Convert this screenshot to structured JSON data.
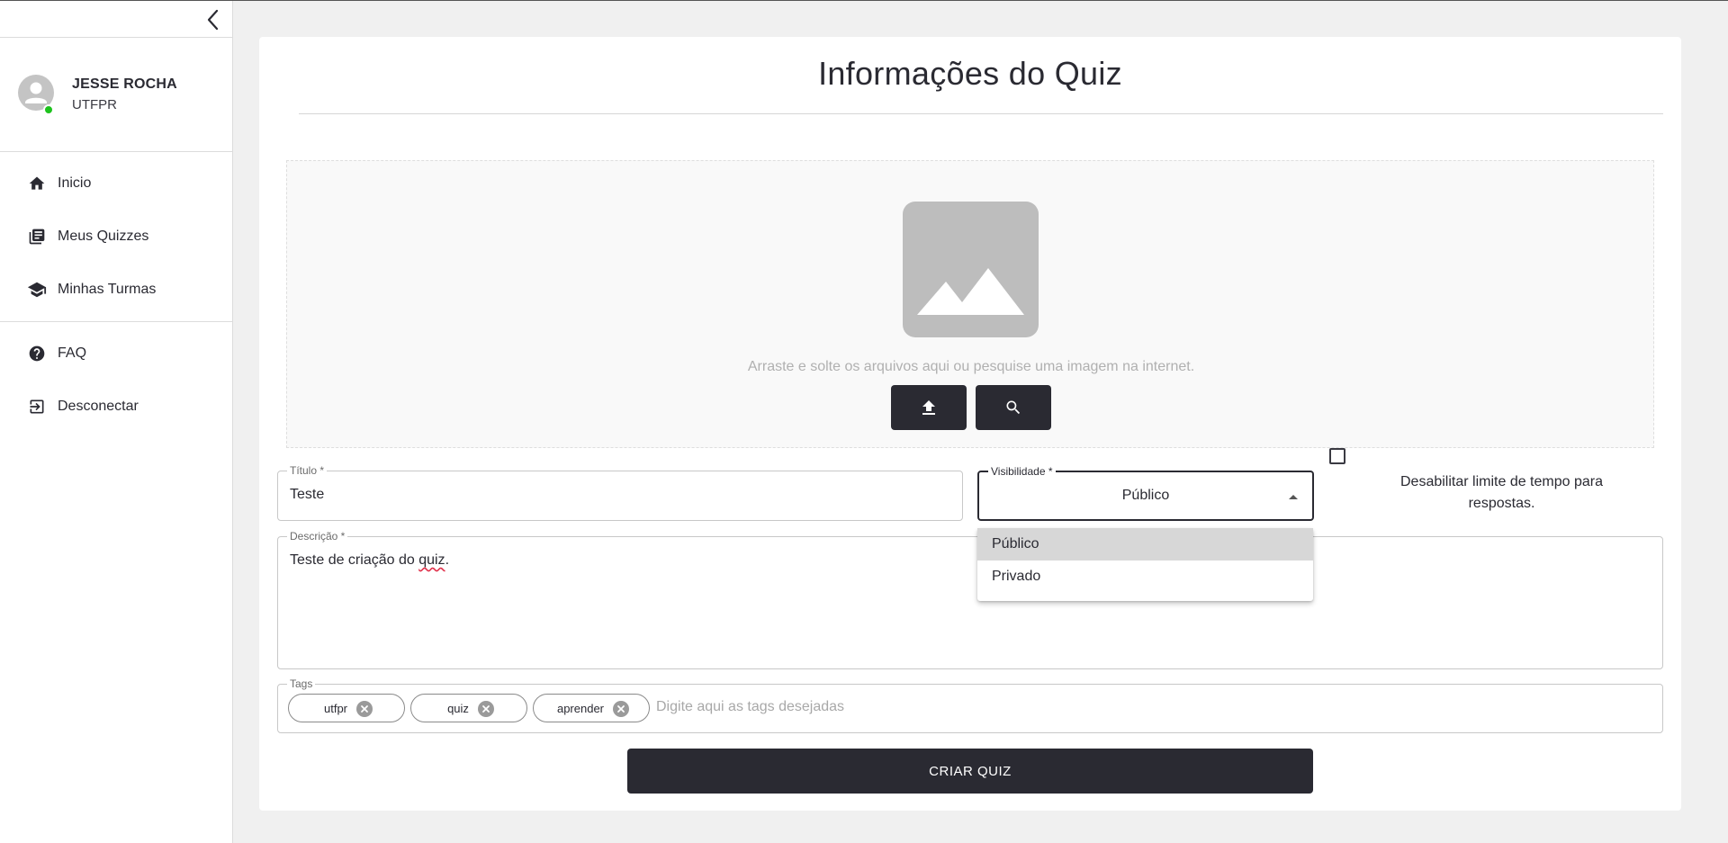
{
  "sidebar": {
    "collapse_icon": "chevron-left-icon",
    "profile": {
      "name": "JESSE ROCHA",
      "org": "UTFPR",
      "status_color": "#1ec31e"
    },
    "items": [
      {
        "label": "Inicio",
        "icon": "home-icon"
      },
      {
        "label": "Meus Quizzes",
        "icon": "library-books-icon"
      },
      {
        "label": "Minhas Turmas",
        "icon": "school-icon"
      },
      {
        "label": "FAQ",
        "icon": "help-circle-icon"
      },
      {
        "label": "Desconectar",
        "icon": "logout-icon"
      }
    ]
  },
  "main": {
    "title": "Informações do Quiz",
    "dropzone": {
      "hint": "Arraste e solte os arquivos aqui ou pesquise uma imagem na internet.",
      "upload_icon": "upload-icon",
      "search_icon": "search-icon"
    },
    "fields": {
      "title": {
        "label": "Título *",
        "value": "Teste"
      },
      "visibility": {
        "label": "Visibilidade *",
        "value": "Público",
        "options": [
          "Público",
          "Privado"
        ],
        "selected_index": 0
      },
      "disable_time_limit": {
        "label": "Desabilitar limite de tempo para respostas.",
        "checked": false
      },
      "description": {
        "label": "Descrição *",
        "value_prefix": "Teste de criação do ",
        "value_misspelled": "quiz",
        "value_suffix": "."
      },
      "tags": {
        "label": "Tags",
        "chips": [
          "utfpr",
          "quiz",
          "aprender"
        ],
        "placeholder": "Digite aqui as tags desejadas"
      }
    },
    "submit_label": "CRIAR QUIZ"
  },
  "colors": {
    "primary_dark": "#2a2a32",
    "background": "#f0f0f0",
    "placeholder_image": "#bdbdbd"
  }
}
